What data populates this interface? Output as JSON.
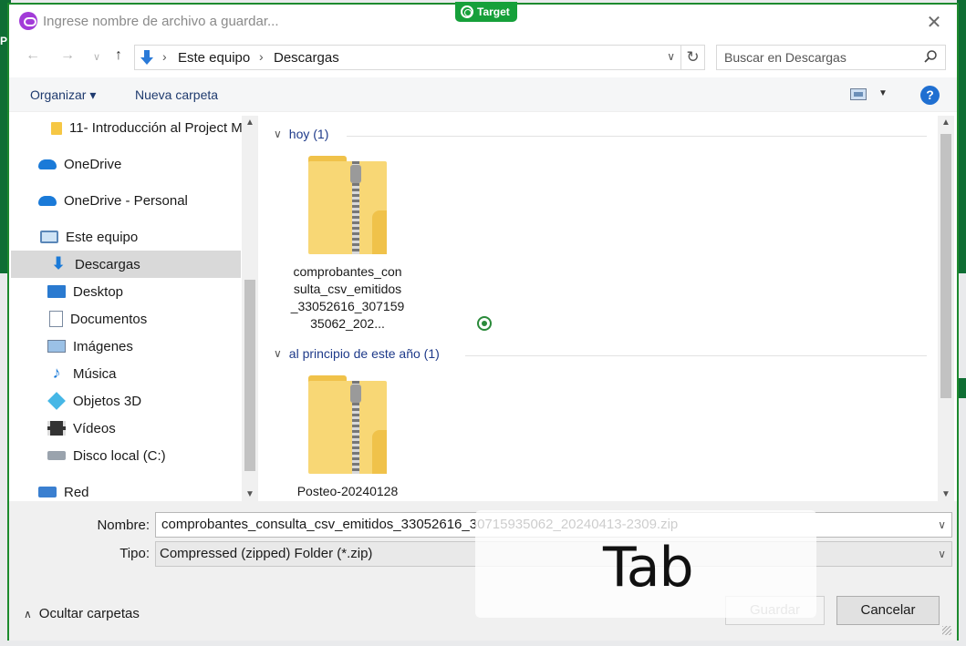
{
  "background": {
    "left_text": "Pr"
  },
  "titlebar": {
    "title": "Ingrese nombre de archivo a guardar...",
    "close": "✕",
    "target_badge": "Target"
  },
  "nav": {
    "back": "←",
    "forward": "→",
    "recent": "∨",
    "up": "↑",
    "breadcrumbs": [
      "Este equipo",
      "Descargas"
    ],
    "refresh": "↻",
    "search_placeholder": "Buscar en Descargas"
  },
  "commands": {
    "organize": "Organizar ▾",
    "new_folder": "Nueva carpeta",
    "view_dropdown": "▼",
    "help": "?"
  },
  "sidebar": {
    "items": [
      {
        "label": "11- Introducción al Project M",
        "icon": "folder-icon"
      },
      {
        "label": "OneDrive",
        "icon": "cloud-icon"
      },
      {
        "label": "OneDrive - Personal",
        "icon": "cloud-icon"
      },
      {
        "label": "Este equipo",
        "icon": "computer-icon"
      },
      {
        "label": "Descargas",
        "icon": "download-icon",
        "selected": true
      },
      {
        "label": "Desktop",
        "icon": "desktop-icon"
      },
      {
        "label": "Documentos",
        "icon": "documents-icon"
      },
      {
        "label": "Imágenes",
        "icon": "images-icon"
      },
      {
        "label": "Música",
        "icon": "music-icon"
      },
      {
        "label": "Objetos 3D",
        "icon": "3d-objects-icon"
      },
      {
        "label": "Vídeos",
        "icon": "video-icon"
      },
      {
        "label": "Disco local (C:)",
        "icon": "disk-icon"
      },
      {
        "label": "Red",
        "icon": "network-icon"
      }
    ]
  },
  "content": {
    "groups": [
      {
        "header": "hoy (1)",
        "files": [
          {
            "name": "comprobantes_consulta_csv_emitidos_33052616_30715935062_202..."
          }
        ]
      },
      {
        "header": "al principio de este año (1)",
        "files": [
          {
            "name": "Posteo-20240128"
          }
        ]
      }
    ]
  },
  "form": {
    "name_label": "Nombre:",
    "name_value": "comprobantes_consulta_csv_emitidos_33052616_30715935062_20240413-2309.zip",
    "type_label": "Tipo:",
    "type_value": "Compressed (zipped) Folder (*.zip)",
    "hide_folders": "Ocultar carpetas",
    "save": "Guardar",
    "cancel": "Cancelar"
  },
  "overlay": {
    "key_text": "Tab"
  },
  "colors": {
    "dialog_border": "#1d8a2e",
    "link_text": "#1e3a8a",
    "selected_row": "#d9d9d9"
  }
}
